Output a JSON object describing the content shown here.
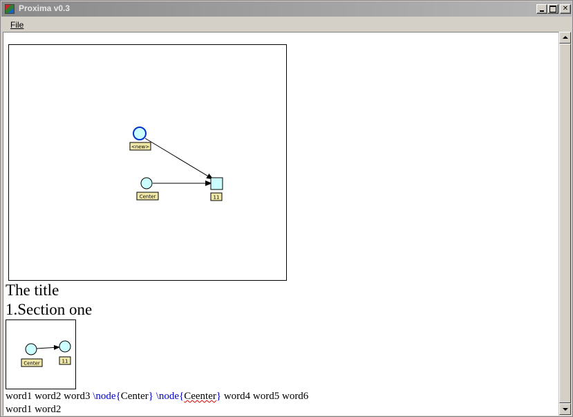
{
  "window": {
    "title": "Proxima v0.3"
  },
  "menu": {
    "file": "File"
  },
  "diagram": {
    "nodes": [
      {
        "label": "<new>"
      },
      {
        "label": "Center"
      },
      {
        "label": "11"
      }
    ]
  },
  "thumbnail": {
    "nodes": [
      {
        "label": "Center"
      },
      {
        "label": "11"
      }
    ]
  },
  "document": {
    "title": "The title",
    "section": "1.Section one",
    "line1": {
      "pre": "word1 word2 word3 ",
      "cmd1": "\\node",
      "brace1_open": "{",
      "arg1": "Center",
      "brace1_close": "}",
      "sep": " ",
      "cmd2": "\\node",
      "brace2_open": "{",
      "arg2": "Ceenter",
      "brace2_close": "}",
      "post": " word4 word5 word6"
    },
    "line2": "word1 word2"
  },
  "colors": {
    "node_fill": "#ccffff",
    "label_fill": "#f0e8a8",
    "command": "#0000cc",
    "selected_node_stroke": "#0033cc"
  }
}
